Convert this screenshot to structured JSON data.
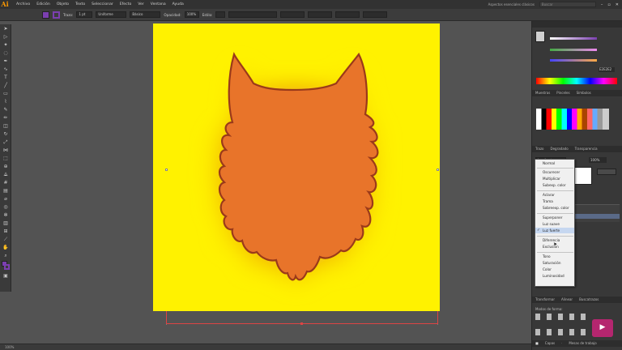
{
  "app": {
    "logo": "Ai"
  },
  "menu": [
    "Archivo",
    "Edición",
    "Objeto",
    "Texto",
    "Seleccionar",
    "Efecto",
    "Ver",
    "Ventana",
    "Ayuda"
  ],
  "topbar": {
    "workspace": "Aspectos esenciales clásicos",
    "search_placeholder": "Buscar"
  },
  "control_bar": {
    "fill_color": "#7b3fb0",
    "stroke_color": "#7b3fb0",
    "stroke_label": "Trazo:",
    "stroke_value": "1 pt",
    "profile": "Uniforme",
    "brush": "Básico",
    "opacity_label": "Opacidad:",
    "opacity_value": "100%",
    "style_label": "Estilo:"
  },
  "colors": {
    "artboard": "#fff200",
    "fox_fill": "#e8742a",
    "fox_outline": "#9a3a1a",
    "glow": "#d96a10",
    "blend_highlight": "#c6d7f0",
    "purple_badge": "#b5266f"
  },
  "right_panel": {
    "color_tabs": [
      "Muestras",
      "Pinceles",
      "Símbolos"
    ],
    "hex_value": "E2E2E2",
    "transparency_tabs": [
      "Trazo",
      "Degradado",
      "Transparencia"
    ],
    "blend_selected": "Luz fuerte",
    "opacity_value": "100%"
  },
  "blend_modes": [
    [
      "Normal"
    ],
    [
      "Oscurecer",
      "Multiplicar",
      "Subexp. color"
    ],
    [
      "Aclarar",
      "Trama",
      "Sobreexp. color"
    ],
    [
      "Superponer",
      "Luz suave",
      "Luz fuerte"
    ],
    [
      "Diferencia",
      "Exclusión"
    ],
    [
      "Tono",
      "Saturación",
      "Color",
      "Luminosidad"
    ]
  ],
  "bottom_panel": {
    "tabs": [
      "Transformar",
      "Alinear",
      "Buscatrazos"
    ],
    "label": "Modos de forma:",
    "footer_tabs": [
      "Capas",
      "Mesas de trabajo"
    ],
    "footer_prefix": "■ ",
    "footer_sep": "  ·  "
  },
  "status": {
    "zoom": "100%"
  },
  "icons": [
    "selection-tool-icon",
    "direct-selection-icon",
    "magic-wand-icon",
    "lasso-icon",
    "pen-tool-icon",
    "curvature-icon",
    "type-tool-icon",
    "line-tool-icon",
    "rectangle-tool-icon",
    "paintbrush-icon",
    "shaper-icon",
    "pencil-icon",
    "eraser-icon",
    "rotate-icon",
    "scale-icon",
    "width-icon",
    "free-transform-icon",
    "shape-builder-icon",
    "perspective-icon",
    "mesh-icon",
    "gradient-icon",
    "eyedropper-icon",
    "blend-icon",
    "symbol-sprayer-icon",
    "graph-icon",
    "artboard-tool-icon",
    "slice-icon",
    "hand-icon",
    "zoom-icon",
    "fill-stroke-icon",
    "screen-mode-icon"
  ]
}
